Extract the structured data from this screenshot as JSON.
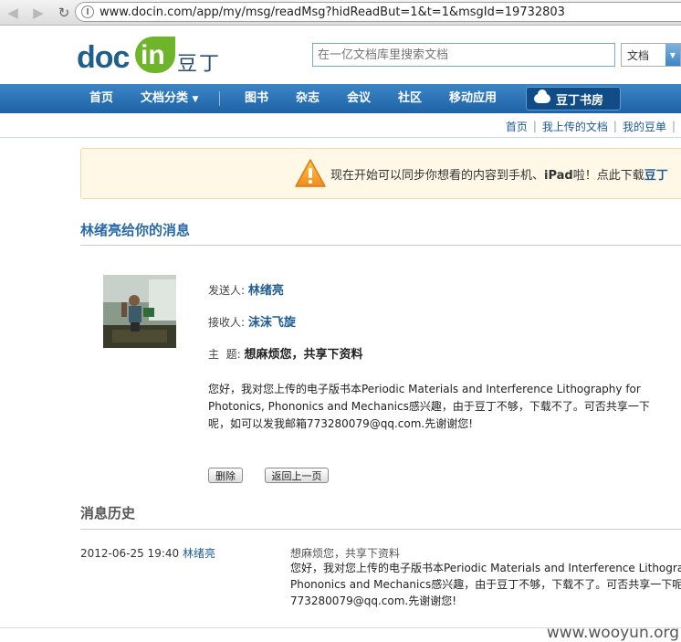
{
  "browser": {
    "url": "www.docin.com/app/my/msg/readMsg?hidReadBut=1&t=1&msgId=19732803",
    "back_icon": "back-arrow-icon",
    "forward_icon": "forward-arrow-icon",
    "reload_icon": "reload-icon"
  },
  "header": {
    "logo_doc": "doc",
    "logo_in": "in",
    "logo_cn": "豆丁",
    "search_placeholder": "在一亿文档库里搜索文档",
    "search_type": "文档"
  },
  "nav": {
    "items": [
      "首页",
      "文档分类",
      "图书",
      "杂志",
      "会议",
      "社区",
      "移动应用"
    ],
    "book_store": "豆丁书房",
    "accent": "#2a6fb3"
  },
  "subnav": {
    "home": "首页",
    "my_docs": "我上传的文档",
    "my_beans": "我的豆单"
  },
  "notice": {
    "text": "现在开始可以同步你想看的内容到手机、",
    "bold": "iPad",
    "text2": "啦！点此下载",
    "link": "豆丁"
  },
  "message": {
    "title": "林绪亮给你的消息",
    "from_label": "发送人:",
    "from": "林绪亮",
    "to_label": "接收人:",
    "to": "沫沫飞旋",
    "subject_label": "主  题:",
    "subject": "想麻烦您，共享下资料",
    "body": "您好，我对您上传的电子版书本Periodic Materials and Interference Lithography for Photonics, Phononics and Mechanics感兴趣，由于豆丁不够，下载不了。可否共享一下呢，如可以发我邮箱773280079@qq.com.先谢谢您!",
    "delete_button": "删除",
    "back_button": "返回上一页"
  },
  "history": {
    "title": "消息历史",
    "date": "2012-06-25 19:40",
    "sender": "林绪亮",
    "subject": "想麻烦您，共享下资料",
    "line1": "您好，我对您上传的电子版书本Periodic Materials and Interference Lithography for",
    "line2": "Phononics and Mechanics感兴趣，由于豆丁不够，下载不了。可否共享一下呢，如",
    "line3": "773280079@qq.com.先谢谢您!"
  },
  "watermark": "www.wooyun.org"
}
